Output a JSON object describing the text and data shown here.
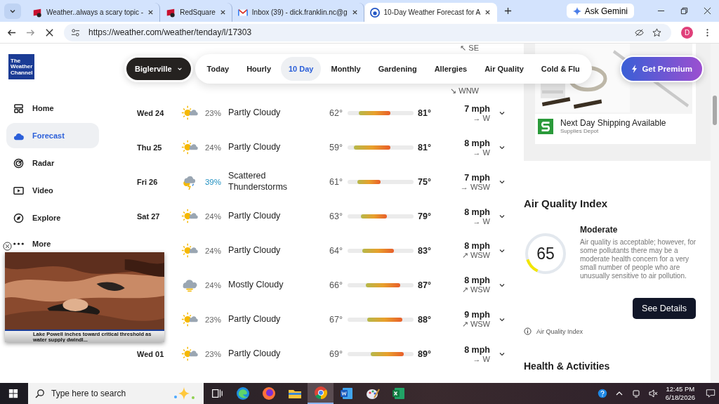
{
  "browser": {
    "tabs": [
      {
        "title": "Weather..always a scary topic -",
        "kind": "square_logo",
        "selected": false
      },
      {
        "title": "RedSquare",
        "kind": "square_logo",
        "selected": false
      },
      {
        "title": "Inbox (39) - dick.franklin.nc@g",
        "kind": "mail",
        "selected": false
      },
      {
        "title": "10-Day Weather Forecast for A",
        "kind": "weather",
        "selected": true
      }
    ],
    "ask_gemini": "Ask Gemini",
    "url": "https://weather.com/weather/tenday/l/17303",
    "profile": "D"
  },
  "site": {
    "logo": "The Weather Channel",
    "sidebar": [
      {
        "label": "Home",
        "kind": "home",
        "selected": false
      },
      {
        "label": "Forecast",
        "kind": "cloud",
        "selected": true
      },
      {
        "label": "Radar",
        "kind": "radar",
        "selected": false
      },
      {
        "label": "Video",
        "kind": "video",
        "selected": false
      },
      {
        "label": "Explore",
        "kind": "compass",
        "selected": false
      },
      {
        "label": "More",
        "kind": "dots",
        "selected": false
      }
    ],
    "location": "Biglerville",
    "nav_tabs": [
      {
        "label": "Today",
        "selected": false
      },
      {
        "label": "Hourly",
        "selected": false
      },
      {
        "label": "10 Day",
        "selected": true
      },
      {
        "label": "Monthly",
        "selected": false
      },
      {
        "label": "Gardening",
        "selected": false
      },
      {
        "label": "Allergies",
        "selected": false
      },
      {
        "label": "Air Quality",
        "selected": false
      },
      {
        "label": "Cold & Flu",
        "selected": false
      }
    ],
    "premium": "Get Premium"
  },
  "partial_winds": [
    "↖ SE",
    "↘ WNW"
  ],
  "days": [
    {
      "day": "Wed 24",
      "kind": "partly_cloudy",
      "precip": "23%",
      "precip_emphasis": false,
      "condition": "Partly Cloudy",
      "low": "62°",
      "high": "81°",
      "speed": "7 mph",
      "dir": "→ W"
    },
    {
      "day": "Thu 25",
      "kind": "partly_cloudy",
      "precip": "24%",
      "precip_emphasis": false,
      "condition": "Partly Cloudy",
      "low": "59°",
      "high": "81°",
      "speed": "8 mph",
      "dir": "→ W"
    },
    {
      "day": "Fri 26",
      "kind": "storm",
      "precip": "39%",
      "precip_emphasis": true,
      "condition": "Scattered Thunderstorms",
      "low": "61°",
      "high": "75°",
      "speed": "7 mph",
      "dir": "→ WSW"
    },
    {
      "day": "Sat 27",
      "kind": "partly_cloudy",
      "precip": "24%",
      "precip_emphasis": false,
      "condition": "Partly Cloudy",
      "low": "63°",
      "high": "79°",
      "speed": "8 mph",
      "dir": "→ W"
    },
    {
      "kind": "partly_cloudy",
      "precip": "24%",
      "precip_emphasis": false,
      "condition": "Partly Cloudy",
      "low": "64°",
      "high": "83°",
      "speed": "8 mph",
      "dir": "↗ WSW"
    },
    {
      "kind": "mostly_cloudy",
      "precip": "24%",
      "precip_emphasis": false,
      "condition": "Mostly Cloudy",
      "low": "66°",
      "high": "87°",
      "speed": "8 mph",
      "dir": "↗ WSW"
    },
    {
      "kind": "partly_cloudy",
      "precip": "23%",
      "precip_emphasis": false,
      "condition": "Partly Cloudy",
      "low": "67°",
      "high": "88°",
      "speed": "9 mph",
      "dir": "↗ WSW"
    },
    {
      "day": "Wed 01",
      "kind": "partly_cloudy",
      "precip": "23%",
      "precip_emphasis": false,
      "condition": "Partly Cloudy",
      "low": "69°",
      "high": "89°",
      "speed": "8 mph",
      "dir": "→ W"
    }
  ],
  "video": {
    "caption": "Lake Powell inches toward critical threshold as water supply dwindl..."
  },
  "ad": {
    "headline": "Next Day Shipping Available",
    "advertiser": "Supplies Depot"
  },
  "air_quality": {
    "title": "Air Quality Index",
    "value": "65",
    "level": 0.13,
    "category": "Moderate",
    "description": "Air quality is acceptable; however, for some pollutants there may be a moderate health concern for a very small number of people who are unusually sensitive to air pollution.",
    "button": "See Details",
    "footnote": "Air Quality Index"
  },
  "next_section": "Health & Activities",
  "taskbar": {
    "search": "Type here to search",
    "apps": [
      {
        "kind": "taskview",
        "selected": false
      },
      {
        "kind": "edge",
        "selected": false
      },
      {
        "kind": "firefox",
        "selected": false
      },
      {
        "kind": "explorer",
        "selected": false
      },
      {
        "kind": "chrome",
        "selected": true
      },
      {
        "kind": "word",
        "selected": false
      },
      {
        "kind": "paint",
        "selected": false
      },
      {
        "kind": "excel",
        "selected": false
      }
    ],
    "time": "12:45 PM",
    "date": "6/18/2026"
  }
}
